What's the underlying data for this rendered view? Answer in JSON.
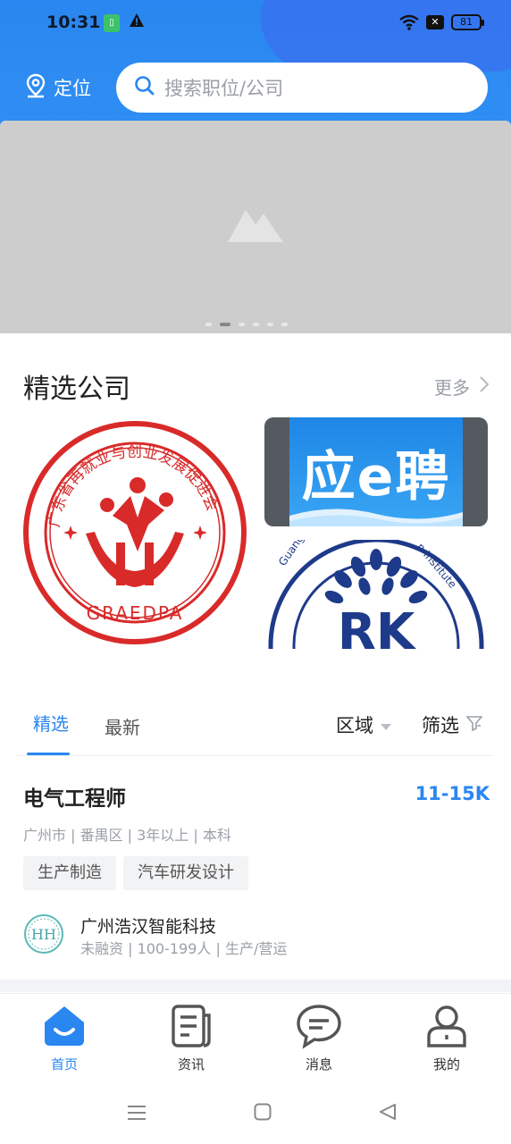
{
  "status_bar": {
    "time": "10:31",
    "battery": "81",
    "icons": [
      "sim-icon",
      "warning-icon",
      "wifi-icon",
      "x-box-icon",
      "battery-icon"
    ]
  },
  "header": {
    "location_label": "定位",
    "search_placeholder": "搜索职位/公司",
    "accent": "#2a86f0"
  },
  "banner": {
    "slide_count": 6,
    "active_index": 1
  },
  "featured": {
    "title": "精选公司",
    "more_label": "更多",
    "companies": [
      {
        "logo": "graedpa-seal-logo",
        "circle_text": "广东省再就业与创业发展促进会",
        "abbr": "GRAEDPA"
      },
      {
        "logo": "ying-e-pin-logo",
        "text": "应e聘"
      },
      {
        "logo": "rk-institute-logo",
        "text": "RK",
        "arc_text_left": "Guangzh",
        "arc_text_right": "n Institute"
      }
    ]
  },
  "tabs": {
    "items": [
      "精选",
      "最新"
    ],
    "selected": "精选",
    "area_label": "区域",
    "filter_label": "筛选"
  },
  "job": {
    "title": "电气工程师",
    "salary": "11-15K",
    "meta": "广州市 | 番禺区 | 3年以上 | 本科",
    "tags": [
      "生产制造",
      "汽车研发设计"
    ],
    "company_name": "广州浩汉智能科技",
    "company_logo_text": "HH",
    "company_meta": "未融资 | 100-199人 | 生产/营运"
  },
  "bottom_nav": {
    "items": [
      {
        "label": "首页",
        "icon": "home-icon"
      },
      {
        "label": "资讯",
        "icon": "news-icon"
      },
      {
        "label": "消息",
        "icon": "message-icon"
      },
      {
        "label": "我的",
        "icon": "profile-icon"
      }
    ],
    "active": "首页"
  },
  "system_nav": [
    "menu-icon",
    "home-square-icon",
    "back-triangle-icon"
  ]
}
